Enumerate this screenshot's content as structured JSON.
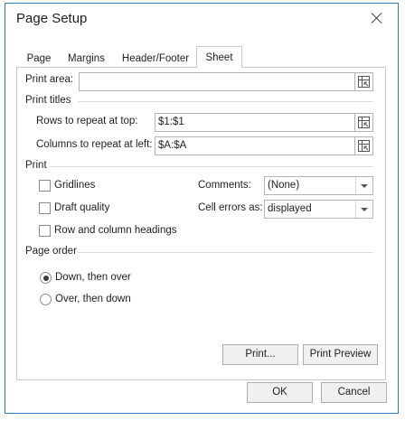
{
  "window": {
    "title": "Page Setup"
  },
  "tabs": [
    "Page",
    "Margins",
    "Header/Footer",
    "Sheet"
  ],
  "active_tab": "Sheet",
  "print_area": {
    "label": "Print area:",
    "value": ""
  },
  "print_titles": {
    "heading": "Print titles",
    "rows_label": "Rows to repeat at top:",
    "rows_value": "$1:$1",
    "cols_label": "Columns to repeat at left:",
    "cols_value": "$A:$A"
  },
  "print": {
    "heading": "Print",
    "gridlines": {
      "label": "Gridlines",
      "checked": false
    },
    "draft_quality": {
      "label": "Draft quality",
      "checked": false
    },
    "row_col_headings": {
      "label": "Row and column headings",
      "checked": false
    },
    "comments_label": "Comments:",
    "comments_value": "(None)",
    "cell_errors_label": "Cell errors as:",
    "cell_errors_value": "displayed"
  },
  "page_order": {
    "heading": "Page order",
    "options": [
      "Down, then over",
      "Over, then down"
    ],
    "selected": "Down, then over"
  },
  "buttons": {
    "print": "Print...",
    "print_preview": "Print Preview",
    "ok": "OK",
    "cancel": "Cancel"
  },
  "colors": {
    "window_border": "#2b78c4",
    "button_face": "#f0f0f0"
  },
  "icons": [
    "close-icon",
    "collapse-range-icon",
    "chevron-down-icon"
  ]
}
